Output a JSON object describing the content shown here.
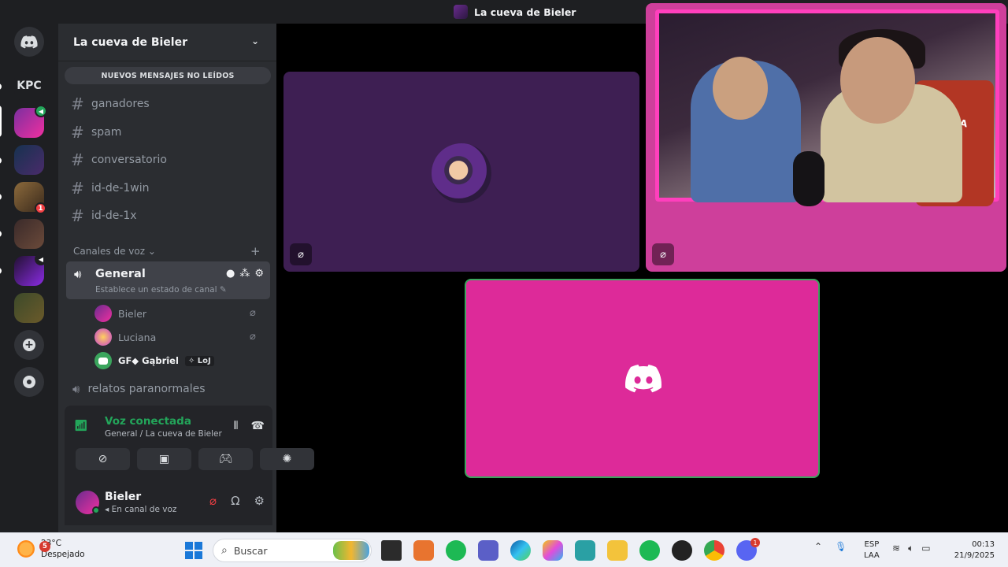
{
  "window": {
    "title": "La cueva de Bieler"
  },
  "rail": {
    "kpc_label": "KPC",
    "badge_unread_1": "1"
  },
  "guild": {
    "name": "La cueva de Bieler",
    "unread_banner": "NUEVOS MENSAJES NO LEÍDOS"
  },
  "text_channels": [
    {
      "name": "ganadores"
    },
    {
      "name": "spam"
    },
    {
      "name": "conversatorio"
    },
    {
      "name": "id-de-1win"
    },
    {
      "name": "id-de-1x"
    }
  ],
  "voice_category": {
    "label": "Canales de voz"
  },
  "voice_general": {
    "name": "General",
    "status_placeholder": "Establece un estado de canal"
  },
  "voice_users": [
    {
      "name": "Bieler"
    },
    {
      "name": "Luciana"
    },
    {
      "name": "GF◆ Gąbrîel",
      "tag": "✧ LoJ"
    }
  ],
  "voice_other": {
    "name": "relatos paranormales"
  },
  "voice_connected": {
    "title": "Voz conectada",
    "subtitle": "General / La cueva de Bieler"
  },
  "user": {
    "name": "Bieler",
    "status": "En canal de voz"
  },
  "stage": {
    "camera_chair_text": "ALPINA"
  },
  "taskbar": {
    "weather_temp": "23°C",
    "weather_desc": "Despejado",
    "weather_badge": "5",
    "search_placeholder": "Buscar",
    "discord_badge": "1",
    "lang_top": "ESP",
    "lang_bottom": "LAA",
    "time": "00:13",
    "date": "21/9/2025"
  },
  "colors": {
    "accent_green": "#23a55a",
    "pink_tile": "#dd2a99",
    "purple_tile": "#3e1f53",
    "danger": "#f23f43"
  }
}
